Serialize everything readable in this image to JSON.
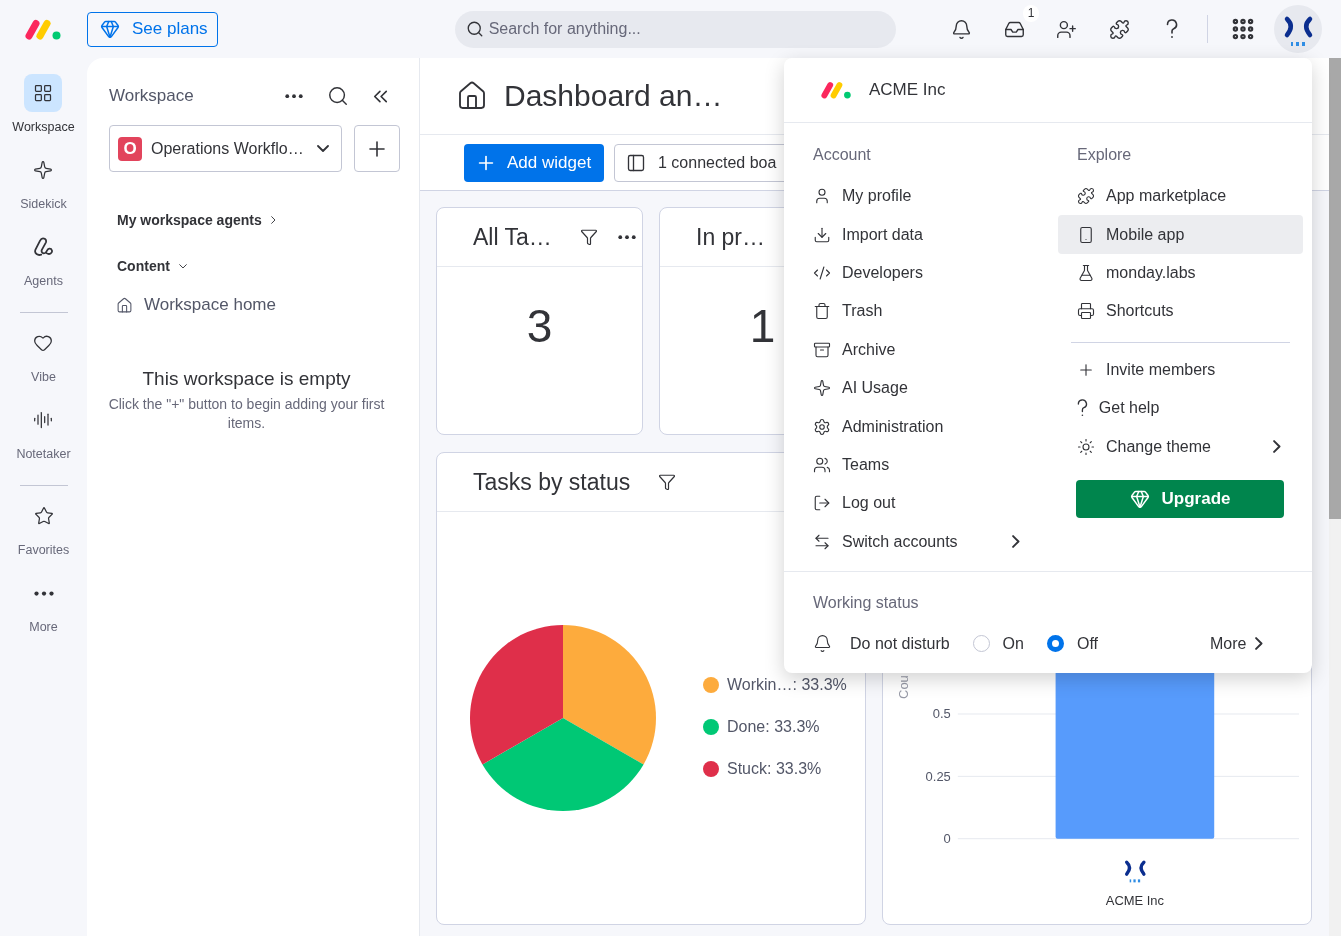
{
  "top_bar": {
    "see_plans": "See plans",
    "search": {
      "placeholder": "Search for anything..."
    },
    "inbox_badge": "1"
  },
  "nav_rail": {
    "groups": [
      [
        {
          "label": "Workspace",
          "selected": true
        },
        {
          "label": "Sidekick",
          "selected": false
        },
        {
          "label": "Agents",
          "selected": false
        }
      ],
      [
        {
          "label": "Vibe",
          "selected": false
        },
        {
          "label": "Notetaker",
          "selected": false
        }
      ],
      [
        {
          "label": "Favorites",
          "selected": false
        },
        {
          "label": "More",
          "selected": false
        }
      ]
    ]
  },
  "workspace_panel": {
    "title": "Workspace",
    "selector": {
      "badge": "O",
      "name": "Operations Workflo…"
    },
    "sections": [
      {
        "label": "My workspace agents",
        "expanded": false
      },
      {
        "label": "Content",
        "expanded": true
      }
    ],
    "items": [
      {
        "label": "Workspace home"
      }
    ],
    "empty_state": {
      "title": "This workspace is empty",
      "text": "Click the \"+\" button to begin adding your first items."
    }
  },
  "dashboard": {
    "title": "Dashboard an…",
    "add_widget": "Add widget",
    "connected_boards": "1 connected boa",
    "widgets": [
      {
        "kind": "number",
        "title": "All Ta…",
        "value": "3",
        "filter": true,
        "menu": true
      },
      {
        "kind": "number",
        "title": "In pr…",
        "value": "1",
        "filter": false,
        "menu": false
      },
      {
        "kind": "chart",
        "title": "Tasks by status",
        "filter": true,
        "menu": false,
        "legend": [
          {
            "label": "Workin…: 33.3%",
            "color": "#fdab3d"
          },
          {
            "label": "Done: 33.3%",
            "color": "#00c875"
          },
          {
            "label": "Stuck: 33.3%",
            "color": "#df2f4a"
          }
        ],
        "chart_data": {
          "type": "pie",
          "series": [
            {
              "values": [
                33.3,
                33.3,
                33.3
              ]
            }
          ]
        }
      },
      {
        "kind": "barchart",
        "y_label": "Cou",
        "y_ticks": [
          "0.5",
          "0.25",
          "0"
        ],
        "x_labels": [
          "ACME Inc"
        ]
      }
    ]
  },
  "account_menu": {
    "org": "ACME Inc",
    "account": {
      "heading": "Account",
      "items": [
        {
          "label": "My profile",
          "submenu": false,
          "highlighted": false
        },
        {
          "label": "Import data",
          "submenu": false,
          "highlighted": false
        },
        {
          "label": "Developers",
          "submenu": false,
          "highlighted": false
        },
        {
          "label": "Trash",
          "submenu": false,
          "highlighted": false
        },
        {
          "label": "Archive",
          "submenu": false,
          "highlighted": false
        },
        {
          "label": "AI Usage",
          "submenu": false,
          "highlighted": false
        },
        {
          "label": "Administration",
          "submenu": false,
          "highlighted": false
        },
        {
          "label": "Teams",
          "submenu": false,
          "highlighted": false
        },
        {
          "label": "Log out",
          "submenu": false,
          "highlighted": false
        },
        {
          "label": "Switch accounts",
          "submenu": true,
          "highlighted": false
        }
      ]
    },
    "explore": {
      "heading": "Explore",
      "groups": [
        [
          {
            "label": "App marketplace",
            "submenu": false,
            "highlighted": false
          },
          {
            "label": "Mobile app",
            "submenu": false,
            "highlighted": true
          },
          {
            "label": "monday.labs",
            "submenu": false,
            "highlighted": false
          },
          {
            "label": "Shortcuts",
            "submenu": false,
            "highlighted": false
          }
        ],
        [
          {
            "label": "Invite members",
            "submenu": false,
            "highlighted": false
          },
          {
            "label": "Get help",
            "submenu": false,
            "highlighted": false
          },
          {
            "label": "Change theme",
            "submenu": true,
            "highlighted": false
          }
        ]
      ],
      "upgrade": "Upgrade"
    },
    "working_status": {
      "heading": "Working status",
      "label": "Do not disturb",
      "options": [
        {
          "label": "On",
          "selected": false
        },
        {
          "label": "Off",
          "selected": true
        }
      ],
      "more": "More"
    }
  }
}
